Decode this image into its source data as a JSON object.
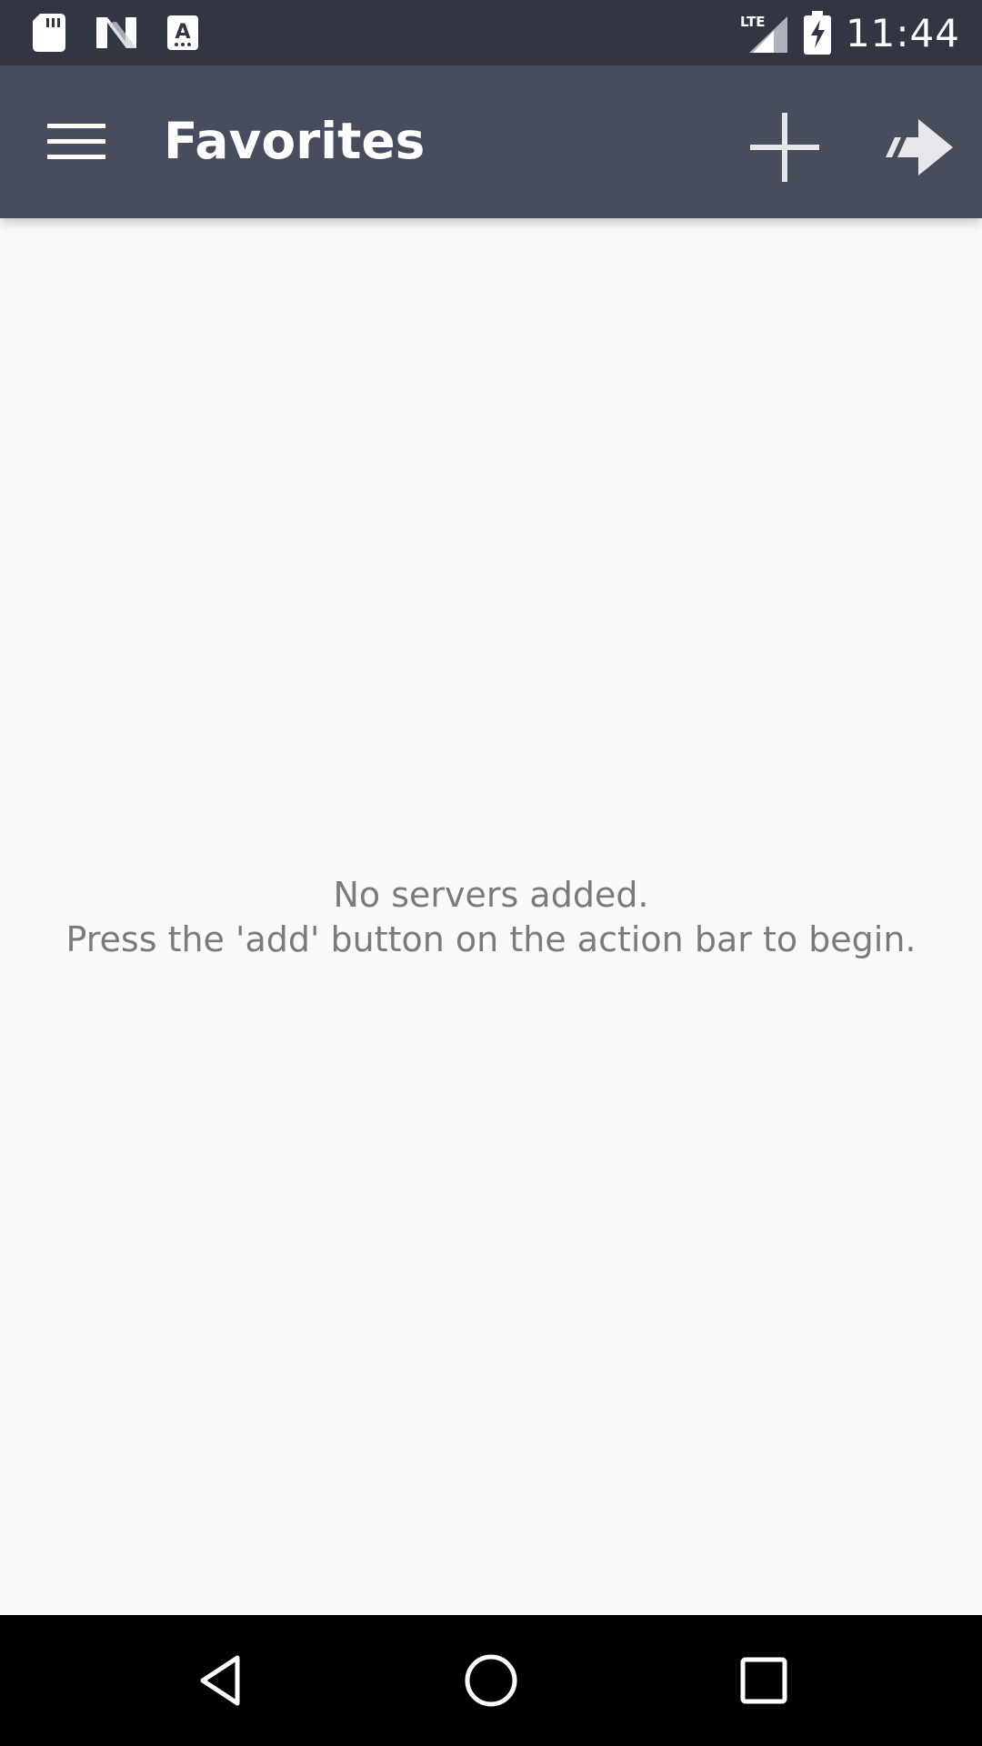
{
  "status_bar": {
    "time": "11:44",
    "network_label": "LTE",
    "left_icons": [
      "sd-card-icon",
      "n-logo-icon",
      "keyboard-a-icon"
    ],
    "right_icons": [
      "signal-icon",
      "battery-charging-icon"
    ]
  },
  "app_bar": {
    "title": "Favorites",
    "menu_icon": "hamburger-menu-icon",
    "actions": [
      "add-icon",
      "forward-arrow-icon"
    ]
  },
  "empty_state": {
    "line1": "No servers added.",
    "line2": "Press the 'add' button on the action bar to begin."
  },
  "navigation": {
    "icons": [
      "back-triangle-icon",
      "home-circle-icon",
      "recents-square-icon"
    ]
  },
  "colors": {
    "status_bar": "#323642",
    "app_bar": "#474d5c",
    "background": "#fafafa",
    "empty_text": "#7b7b7b",
    "navigation_bar": "#000000"
  }
}
